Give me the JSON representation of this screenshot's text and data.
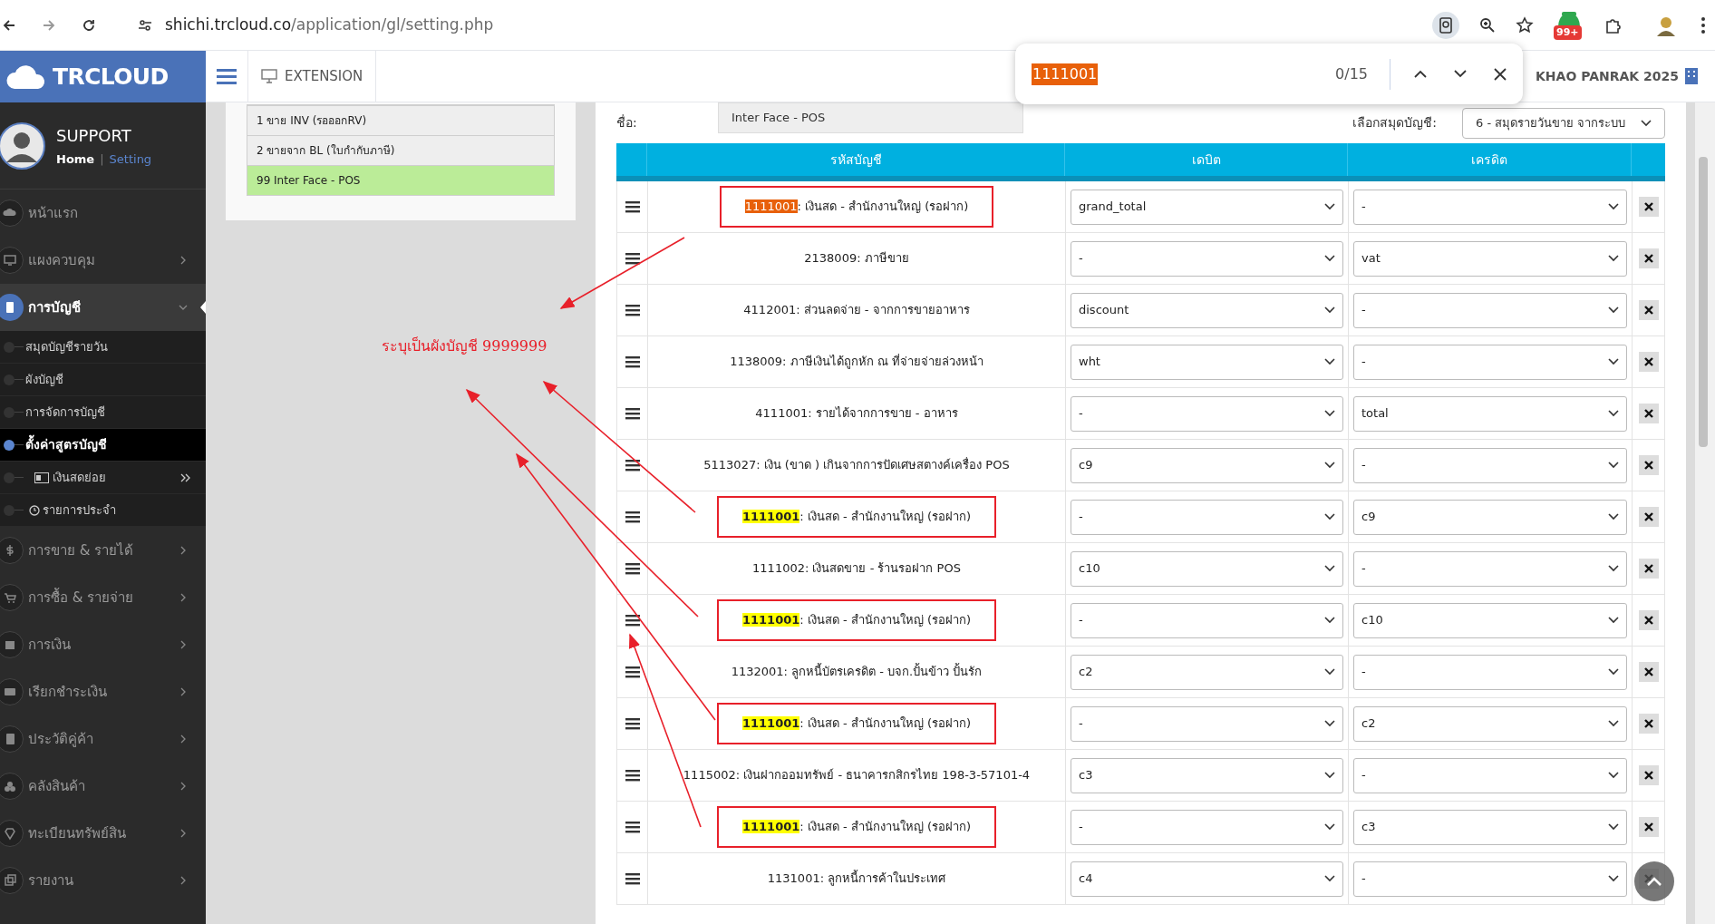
{
  "browser": {
    "url_host": "shichi.trcloud.co",
    "url_path": "/application/gl/setting.php",
    "extension_badge": "99+"
  },
  "find_bar": {
    "query": "1111001",
    "count": "0/15"
  },
  "header": {
    "logo": "TRCLOUD",
    "extension": "EXTENSION",
    "company": "KHAO PANRAK 2025"
  },
  "sidebar": {
    "user": "SUPPORT",
    "home_link": "Home",
    "divider": "|",
    "setting_link": "Setting",
    "items": [
      {
        "label": "หน้าแรก",
        "expanded": false,
        "has_children": false
      },
      {
        "label": "แผงควบคุม",
        "expanded": false,
        "has_children": true
      },
      {
        "label": "การบัญชี",
        "expanded": true,
        "has_children": true,
        "children": [
          {
            "label": "สมุดบัญชีรายวัน",
            "selected": false
          },
          {
            "label": "ผังบัญชี",
            "selected": false
          },
          {
            "label": "การจัดการบัญชี",
            "selected": false
          },
          {
            "label": "ตั้งค่าสูตรบัญชี",
            "selected": true
          },
          {
            "label": "เงินสดย่อย",
            "selected": false,
            "kind": "submenu"
          },
          {
            "label": "รายการประจำ",
            "selected": false,
            "kind": "clock"
          }
        ]
      },
      {
        "label": "การขาย & รายได้",
        "expanded": false,
        "has_children": true
      },
      {
        "label": "การซื้อ & รายจ่าย",
        "expanded": false,
        "has_children": true
      },
      {
        "label": "การเงิน",
        "expanded": false,
        "has_children": true
      },
      {
        "label": "เรียกชำระเงิน",
        "expanded": false,
        "has_children": true
      },
      {
        "label": "ประวัติคู่ค้า",
        "expanded": false,
        "has_children": true
      },
      {
        "label": "คลังสินค้า",
        "expanded": false,
        "has_children": true
      },
      {
        "label": "ทะเบียนทรัพย์สิน",
        "expanded": false,
        "has_children": true
      },
      {
        "label": "รายงาน",
        "expanded": false,
        "has_children": true
      }
    ]
  },
  "formula_list": [
    {
      "label": "1 ขาย INV (รอออกRV)",
      "selected": false
    },
    {
      "label": "2 ขายจาก BL (ใบกำกับภาษี)",
      "selected": false
    },
    {
      "label": "99 Inter Face - POS",
      "selected": true
    }
  ],
  "form": {
    "name_label": "ชื่อ:",
    "name_value": "Inter Face - POS",
    "journal_label": "เลือกสมุดบัญชี:",
    "journal_value": "6 - สมุดรายวันขาย จากระบบ"
  },
  "table": {
    "columns": [
      "รหัสบัญชี",
      "เดบิต",
      "เครดิต"
    ],
    "rows": [
      {
        "code": "1111001",
        "name": ": เงินสด - สำนักงานใหญ่ (รอฝาก)",
        "find_match": true,
        "active_match": true,
        "annotated": true,
        "debit": "grand_total",
        "credit": "-"
      },
      {
        "code": "2138009",
        "name": ": ภาษีขาย",
        "find_match": false,
        "active_match": false,
        "annotated": false,
        "debit": "-",
        "credit": "vat"
      },
      {
        "code": "4112001",
        "name": ": ส่วนลดจ่าย - จากการขายอาหาร",
        "find_match": false,
        "active_match": false,
        "annotated": false,
        "debit": "discount",
        "credit": "-"
      },
      {
        "code": "1138009",
        "name": ": ภาษีเงินได้ถูกหัก ณ ที่จ่ายจ่ายล่วงหน้า",
        "find_match": false,
        "active_match": false,
        "annotated": false,
        "debit": "wht",
        "credit": "-"
      },
      {
        "code": "4111001",
        "name": ": รายได้จากการขาย - อาหาร",
        "find_match": false,
        "active_match": false,
        "annotated": false,
        "debit": "-",
        "credit": "total"
      },
      {
        "code": "5113027",
        "name": ": เงิน (ขาด ) เกินจากการปัดเศษสตางค์เครื่อง POS",
        "find_match": false,
        "active_match": false,
        "annotated": false,
        "debit": "c9",
        "credit": "-"
      },
      {
        "code": "1111001",
        "name": ": เงินสด - สำนักงานใหญ่ (รอฝาก)",
        "find_match": true,
        "active_match": false,
        "annotated": true,
        "debit": "-",
        "credit": "c9"
      },
      {
        "code": "1111002",
        "name": ": เงินสดขาย - ร้านรอฝาก POS",
        "find_match": false,
        "active_match": false,
        "annotated": false,
        "debit": "c10",
        "credit": "-"
      },
      {
        "code": "1111001",
        "name": ": เงินสด - สำนักงานใหญ่ (รอฝาก)",
        "find_match": true,
        "active_match": false,
        "annotated": true,
        "debit": "-",
        "credit": "c10"
      },
      {
        "code": "1132001",
        "name": ": ลูกหนี้บัตรเครดิต - บจก.ปั้นข้าว ปั้นรัก",
        "find_match": false,
        "active_match": false,
        "annotated": false,
        "debit": "c2",
        "credit": "-"
      },
      {
        "code": "1111001",
        "name": ": เงินสด - สำนักงานใหญ่ (รอฝาก)",
        "find_match": true,
        "active_match": false,
        "annotated": true,
        "debit": "-",
        "credit": "c2"
      },
      {
        "code": "1115002",
        "name": ": เงินฝากออมทรัพย์ - ธนาคารกสิกรไทย 198-3-57101-4",
        "find_match": false,
        "active_match": false,
        "annotated": false,
        "debit": "c3",
        "credit": "-"
      },
      {
        "code": "1111001",
        "name": ": เงินสด - สำนักงานใหญ่ (รอฝาก)",
        "find_match": true,
        "active_match": false,
        "annotated": true,
        "debit": "-",
        "credit": "c3"
      },
      {
        "code": "1131001",
        "name": ": ลูกหนี้การค้าในประเทศ",
        "find_match": false,
        "active_match": false,
        "annotated": false,
        "debit": "c4",
        "credit": "-"
      }
    ]
  },
  "annotation": {
    "note": "ระบุเป็นผังบัญชี 9999999"
  }
}
